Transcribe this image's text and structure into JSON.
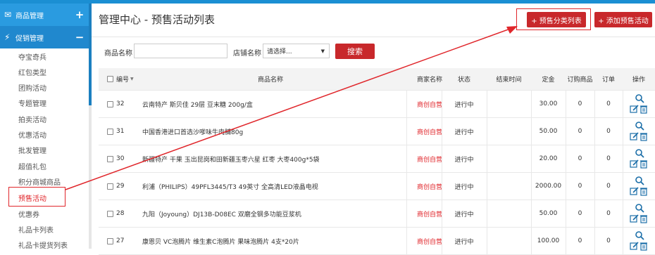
{
  "sidebar": {
    "sections": [
      {
        "label": "商品管理",
        "icon": "envelope-icon",
        "toggle": "+"
      },
      {
        "label": "促销管理",
        "icon": "lightning-icon",
        "toggle": "−"
      }
    ],
    "items": [
      "夺宝奇兵",
      "红包类型",
      "团购活动",
      "专题管理",
      "拍卖活动",
      "优惠活动",
      "批发管理",
      "超值礼包",
      "积分商城商品",
      "预售活动",
      "优惠券",
      "礼品卡列表",
      "礼品卡提货列表"
    ],
    "active_item": "预售活动"
  },
  "header": {
    "title": "管理中心 - 预售活动列表",
    "buttons": [
      "+ 预售分类列表",
      "+ 添加预售活动"
    ]
  },
  "search": {
    "name_label": "商品名称",
    "name_value": "",
    "store_label": "店铺名称",
    "store_select": "请选择...",
    "submit_label": "搜索"
  },
  "table": {
    "columns": [
      "编号",
      "商品名称",
      "商家名称",
      "状态",
      "结束时间",
      "定金",
      "订购商品",
      "订单",
      "操作"
    ],
    "rows": [
      {
        "id": "32",
        "name": "云南特产 斯贝佳 29层 豆末糖 200g/盒",
        "seller": "商创自营",
        "status": "进行中",
        "end": "",
        "deposit": "30.00",
        "ordered": "0",
        "orders": "0"
      },
      {
        "id": "31",
        "name": "中国香港进口首选沙嗲味牛肉脯80g",
        "seller": "商创自营",
        "status": "进行中",
        "end": "",
        "deposit": "50.00",
        "ordered": "0",
        "orders": "0"
      },
      {
        "id": "30",
        "name": "新疆特产 干果 玉出昆岗和田新疆玉枣六星 红枣 大枣400g*5袋",
        "seller": "商创自营",
        "status": "进行中",
        "end": "",
        "deposit": "20.00",
        "ordered": "0",
        "orders": "0"
      },
      {
        "id": "29",
        "name": "利浦（PHILIPS）49PFL3445/T3 49英寸 全高清LED液晶电视",
        "seller": "商创自营",
        "status": "进行中",
        "end": "",
        "deposit": "2000.00",
        "ordered": "0",
        "orders": "0"
      },
      {
        "id": "28",
        "name": "九阳（Joyoung）DJ13B-D08EC 双磨全钢多功能豆浆机",
        "seller": "商创自营",
        "status": "进行中",
        "end": "",
        "deposit": "50.00",
        "ordered": "0",
        "orders": "0"
      },
      {
        "id": "27",
        "name": "康恩贝 VC泡腾片 维生素C泡腾片 果味泡腾片 4支*20片",
        "seller": "商创自营",
        "status": "进行中",
        "end": "",
        "deposit": "100.00",
        "ordered": "0",
        "orders": "0"
      }
    ]
  },
  "colors": {
    "accent_blue": "#2a9be0",
    "action_red": "#c8282b",
    "highlight_red": "#e0262b"
  }
}
